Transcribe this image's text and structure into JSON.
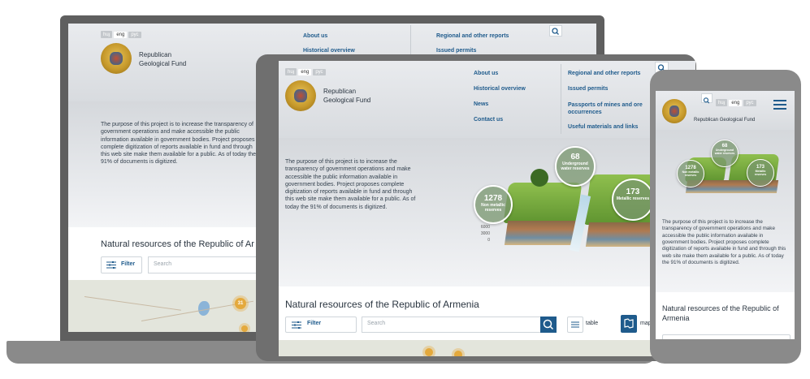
{
  "site": {
    "name": "Republican Geological Fund",
    "name_line1": "Republican",
    "name_line2": "Geological Fund",
    "languages": [
      "huյ",
      "eng",
      "рус"
    ],
    "active_language": "eng",
    "nav_left": [
      "About us",
      "Historical overview",
      "News",
      "Contact us"
    ],
    "nav_right": [
      "Regional and other reports",
      "Issued permits",
      "Passports of mines and ore occurrences",
      "Useful materials and links"
    ],
    "description": "The purpose of this project is to increase the transparency of government operations and make accessible the public information available in government bodies. Project proposes complete digitization of reports available in fund and through this web site make them available for a public. As of today the 91% of documents is digitized.",
    "resources_title": "Natural resources of the Republic of Armenia",
    "laptop_resources_title": "Natural resources of the Republic of Ar",
    "filter_label": "Filter",
    "search_placeholder": "Search",
    "table_label": "table",
    "map_label": "map"
  },
  "stats": {
    "nonmetallic": {
      "value": "1278",
      "label": "Non metallic reserves"
    },
    "underground": {
      "value": "68",
      "label": "Underground water reserves"
    },
    "metallic": {
      "value": "173",
      "label": "Metallic reserves"
    }
  },
  "depth_scale": [
    "6000",
    "3000",
    "0"
  ],
  "map_markers": [
    "31"
  ],
  "colors": {
    "brand_blue": "#1f5b8c",
    "marker": "#e4a93c",
    "device_dark": "#5f5f5f",
    "device_light": "#8a8a8a"
  },
  "icons": {
    "search": "magnifier",
    "filter": "sliders",
    "table": "list",
    "map": "map-pin",
    "menu": "hamburger"
  }
}
